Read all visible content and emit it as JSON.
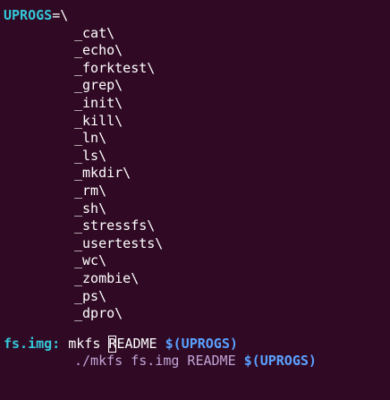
{
  "editor": {
    "var_name": "UPROGS",
    "var_assign": "=\\",
    "items": [
      "_cat\\",
      "_echo\\",
      "_forktest\\",
      "_grep\\",
      "_init\\",
      "_kill\\",
      "_ln\\",
      "_ls\\",
      "_mkdir\\",
      "_rm\\",
      "_sh\\",
      "_stressfs\\",
      "_usertests\\",
      "_wc\\",
      "_zombie\\",
      "_ps\\",
      "_dpro\\"
    ],
    "target": {
      "name": "fs.img:",
      "cmd_prefix": " mkfs ",
      "cursor_char": "R",
      "cmd_rest": "EADME ",
      "dollar": "$(UPROGS)",
      "recipe_prefix": "./mkfs fs.img README ",
      "recipe_dollar": "$(UPROGS)"
    }
  },
  "colors": {
    "background": "#300a24",
    "variable": "#34c6d9",
    "dollar": "#5aa0ff",
    "recipe": "#c0a3d6"
  }
}
